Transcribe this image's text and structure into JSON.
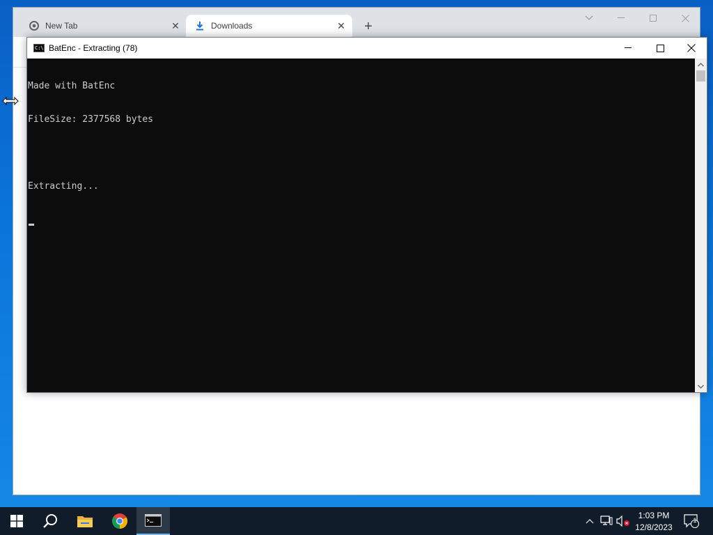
{
  "browser": {
    "tabs": [
      {
        "label": "New Tab",
        "icon": "chrome-icon",
        "active": false
      },
      {
        "label": "Downloads",
        "icon": "download-icon",
        "active": true
      }
    ],
    "new_tab_label": "+"
  },
  "console": {
    "title": "BatEnc - Extracting (78)",
    "lines": [
      "Made with BatEnc",
      "FileSize: 2377568 bytes",
      "",
      "Extracting..."
    ],
    "colors": {
      "background": "#0c0c0c",
      "text": "#cccccc"
    }
  },
  "taskbar": {
    "apps": [
      "start-icon",
      "search-icon",
      "file-explorer-icon",
      "chrome-icon",
      "console-icon"
    ],
    "clock_time": "1:03 PM",
    "clock_date": "12/8/2023",
    "notification_count": "1"
  }
}
